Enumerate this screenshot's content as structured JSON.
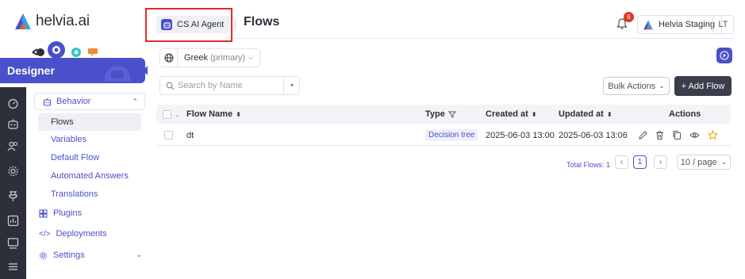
{
  "brand": {
    "name": "helvia.ai"
  },
  "header": {
    "agent_label": "CS AI Agent",
    "page_title": "Flows",
    "notifications_count": "6",
    "org_label": "Helvia Staging",
    "avatar_initials": "LT"
  },
  "sidebar": {
    "section_title": "Designer",
    "behavior": {
      "label": "Behavior",
      "items": [
        {
          "label": "Flows",
          "active": true
        },
        {
          "label": "Variables"
        },
        {
          "label": "Default Flow"
        },
        {
          "label": "Automated Answers"
        },
        {
          "label": "Translations"
        }
      ]
    },
    "plugins_label": "Plugins",
    "deployments_label": "Deployments",
    "settings_label": "Settings"
  },
  "language": {
    "value": "Greek",
    "suffix": "(primary)"
  },
  "search": {
    "placeholder": "Search by Name"
  },
  "toolbar": {
    "bulk_actions": "Bulk Actions",
    "add_flow": "+ Add Flow"
  },
  "table": {
    "columns": [
      "Flow Name",
      "Type",
      "Created at",
      "Updated at",
      "Actions"
    ],
    "rows": [
      {
        "name": "dt",
        "type": "Decision tree",
        "created": "2025-06-03 13:00",
        "updated": "2025-06-03 13:06"
      }
    ]
  },
  "pagination": {
    "total_label": "Total Flows: 1",
    "current_page": "1",
    "page_size": "10 / page"
  },
  "colors": {
    "accent": "#4a50c9",
    "dark": "#2d2f3a",
    "highlight_box": "#e02a2a"
  }
}
